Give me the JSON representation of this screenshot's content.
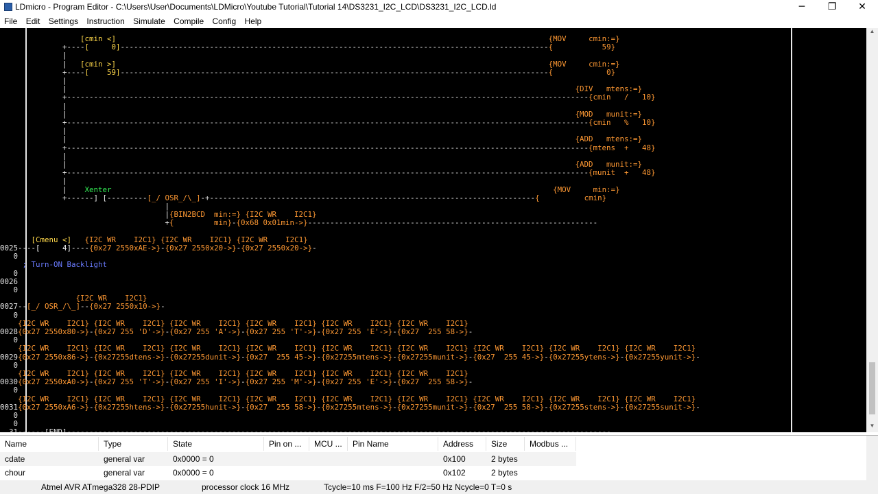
{
  "window": {
    "title": "LDmicro - Program Editor - C:\\Users\\User\\Documents\\LDMicro\\Youtube Tutorial\\Tutorial 14\\DS3231_I2C_LCD\\DS3231_I2C_LCD.ld",
    "minimize": "─",
    "maximize": "❐",
    "close": "✕"
  },
  "menu": [
    "File",
    "Edit",
    "Settings",
    "Instruction",
    "Simulate",
    "Compile",
    "Config",
    "Help"
  ],
  "editor": {
    "lines": [
      [
        {
          "t": "                  ",
          "c": "w"
        },
        {
          "t": "[cmin <]",
          "c": "y"
        },
        {
          "t": "                                                                                                 ",
          "c": "w"
        },
        {
          "t": "{MOV     cmin:=}",
          "c": "o"
        }
      ],
      [
        {
          "t": "              +----",
          "c": "w"
        },
        {
          "t": "[     0]",
          "c": "y"
        },
        {
          "t": "------------------------------------------------------------------------------------------------",
          "c": "w"
        },
        {
          "t": "{           59}",
          "c": "o"
        }
      ],
      [
        {
          "t": "              |",
          "c": "w"
        }
      ],
      [
        {
          "t": "              |   ",
          "c": "w"
        },
        {
          "t": "[cmin >]",
          "c": "y"
        },
        {
          "t": "                                                                                                 ",
          "c": "w"
        },
        {
          "t": "{MOV     cmin:=}",
          "c": "o"
        }
      ],
      [
        {
          "t": "              +----",
          "c": "w"
        },
        {
          "t": "[    59]",
          "c": "y"
        },
        {
          "t": "------------------------------------------------------------------------------------------------",
          "c": "w"
        },
        {
          "t": "{            0}",
          "c": "o"
        }
      ],
      [
        {
          "t": "              |",
          "c": "w"
        }
      ],
      [
        {
          "t": "              |                                                                                                                  ",
          "c": "w"
        },
        {
          "t": "{DIV   mtens:=}",
          "c": "o"
        }
      ],
      [
        {
          "t": "              +---------------------------------------------------------------------------------------------------------------------",
          "c": "w"
        },
        {
          "t": "{cmin   /   10}",
          "c": "o"
        }
      ],
      [
        {
          "t": "              |",
          "c": "w"
        }
      ],
      [
        {
          "t": "              |                                                                                                                  ",
          "c": "w"
        },
        {
          "t": "{MOD   munit:=}",
          "c": "o"
        }
      ],
      [
        {
          "t": "              +---------------------------------------------------------------------------------------------------------------------",
          "c": "w"
        },
        {
          "t": "{cmin   %   10}",
          "c": "o"
        }
      ],
      [
        {
          "t": "              |",
          "c": "w"
        }
      ],
      [
        {
          "t": "              |                                                                                                                  ",
          "c": "w"
        },
        {
          "t": "{ADD   mtens:=}",
          "c": "o"
        }
      ],
      [
        {
          "t": "              +---------------------------------------------------------------------------------------------------------------------",
          "c": "w"
        },
        {
          "t": "{mtens  +   48}",
          "c": "o"
        }
      ],
      [
        {
          "t": "              |",
          "c": "w"
        }
      ],
      [
        {
          "t": "              |                                                                                                                  ",
          "c": "w"
        },
        {
          "t": "{ADD   munit:=}",
          "c": "o"
        }
      ],
      [
        {
          "t": "              +---------------------------------------------------------------------------------------------------------------------",
          "c": "w"
        },
        {
          "t": "{munit  +   48}",
          "c": "o"
        }
      ],
      [
        {
          "t": "              |",
          "c": "w"
        }
      ],
      [
        {
          "t": "              |    ",
          "c": "w"
        },
        {
          "t": "Xenter",
          "c": "g"
        },
        {
          "t": "                                                                                                   ",
          "c": "w"
        },
        {
          "t": "{MOV     min:=}",
          "c": "o"
        }
      ],
      [
        {
          "t": "              +------] [---------",
          "c": "w"
        },
        {
          "t": "[_/ OSR_/\\_]",
          "c": "o"
        },
        {
          "t": "-+-------------------------------------------------------------------------",
          "c": "w"
        },
        {
          "t": "{          cmin}",
          "c": "o"
        }
      ],
      [
        {
          "t": "                                     |",
          "c": "w"
        }
      ],
      [
        {
          "t": "                                     |",
          "c": "w"
        },
        {
          "t": "{BIN2BCD  min:=}",
          "c": "o"
        },
        {
          "t": " ",
          "c": "w"
        },
        {
          "t": "{I2C WR    I2C1}",
          "c": "o"
        }
      ],
      [
        {
          "t": "                                     +",
          "c": "w"
        },
        {
          "t": "{         min}",
          "c": "o"
        },
        {
          "t": "-",
          "c": "w"
        },
        {
          "t": "{0x68 0x01min->}",
          "c": "o"
        },
        {
          "t": "-----------------------------------------------------------------",
          "c": "w"
        }
      ],
      [
        {
          "t": ""
        }
      ],
      [
        {
          "t": "       ",
          "c": "w"
        },
        {
          "t": "[Cmenu <]",
          "c": "y"
        },
        {
          "t": "   ",
          "c": "w"
        },
        {
          "t": "{I2C WR    I2C1}",
          "c": "o"
        },
        {
          "t": " ",
          "c": "w"
        },
        {
          "t": "{I2C WR    I2C1}",
          "c": "o"
        },
        {
          "t": " ",
          "c": "w"
        },
        {
          "t": "{I2C WR    I2C1}",
          "c": "o"
        }
      ],
      [
        {
          "t": "0025",
          "c": "w"
        },
        {
          "t": "----[     4]----",
          "c": "w"
        },
        {
          "t": "{0x27 2550xAE->}",
          "c": "o"
        },
        {
          "t": "-",
          "c": "w"
        },
        {
          "t": "{0x27 2550x20->}",
          "c": "o"
        },
        {
          "t": "-",
          "c": "w"
        },
        {
          "t": "{0x27 2550x20->}",
          "c": "o"
        },
        {
          "t": "-",
          "c": "w"
        }
      ],
      [
        {
          "t": "   0",
          "c": "w"
        }
      ],
      [
        {
          "t": "    ",
          "c": "w"
        },
        {
          "t": " ; Turn-ON Backlight",
          "c": "c"
        }
      ],
      [
        {
          "t": "   0",
          "c": "w"
        }
      ],
      [
        {
          "t": "0026",
          "c": "w"
        }
      ],
      [
        {
          "t": "   0",
          "c": "w"
        }
      ],
      [
        {
          "t": "                 ",
          "c": "w"
        },
        {
          "t": "{I2C WR    I2C1}",
          "c": "o"
        }
      ],
      [
        {
          "t": "0027",
          "c": "w"
        },
        {
          "t": "--",
          "c": "w"
        },
        {
          "t": "[_/ OSR_/\\_]",
          "c": "o"
        },
        {
          "t": "--",
          "c": "w"
        },
        {
          "t": "{0x27 2550x10->}",
          "c": "o"
        },
        {
          "t": "-",
          "c": "w"
        }
      ],
      [
        {
          "t": "   0",
          "c": "w"
        }
      ],
      [
        {
          "t": "    ",
          "c": "w"
        },
        {
          "t": "{I2C WR    I2C1}",
          "c": "o"
        },
        {
          "t": " ",
          "c": "w"
        },
        {
          "t": "{I2C WR    I2C1}",
          "c": "o"
        },
        {
          "t": " ",
          "c": "w"
        },
        {
          "t": "{I2C WR    I2C1}",
          "c": "o"
        },
        {
          "t": " ",
          "c": "w"
        },
        {
          "t": "{I2C WR    I2C1}",
          "c": "o"
        },
        {
          "t": " ",
          "c": "w"
        },
        {
          "t": "{I2C WR    I2C1}",
          "c": "o"
        },
        {
          "t": " ",
          "c": "w"
        },
        {
          "t": "{I2C WR    I2C1}",
          "c": "o"
        }
      ],
      [
        {
          "t": "0028",
          "c": "w"
        },
        {
          "t": "{0x27 2550x80->}",
          "c": "o"
        },
        {
          "t": "-",
          "c": "w"
        },
        {
          "t": "{0x27 255 'D'->}",
          "c": "o"
        },
        {
          "t": "-",
          "c": "w"
        },
        {
          "t": "{0x27 255 'A'->}",
          "c": "o"
        },
        {
          "t": "-",
          "c": "w"
        },
        {
          "t": "{0x27 255 'T'->}",
          "c": "o"
        },
        {
          "t": "-",
          "c": "w"
        },
        {
          "t": "{0x27 255 'E'->}",
          "c": "o"
        },
        {
          "t": "-",
          "c": "w"
        },
        {
          "t": "{0x27  255 58->}",
          "c": "o"
        },
        {
          "t": "-",
          "c": "w"
        }
      ],
      [
        {
          "t": "   0",
          "c": "w"
        }
      ],
      [
        {
          "t": "    ",
          "c": "w"
        },
        {
          "t": "{I2C WR    I2C1}",
          "c": "o"
        },
        {
          "t": " ",
          "c": "w"
        },
        {
          "t": "{I2C WR    I2C1}",
          "c": "o"
        },
        {
          "t": " ",
          "c": "w"
        },
        {
          "t": "{I2C WR    I2C1}",
          "c": "o"
        },
        {
          "t": " ",
          "c": "w"
        },
        {
          "t": "{I2C WR    I2C1}",
          "c": "o"
        },
        {
          "t": " ",
          "c": "w"
        },
        {
          "t": "{I2C WR    I2C1}",
          "c": "o"
        },
        {
          "t": " ",
          "c": "w"
        },
        {
          "t": "{I2C WR    I2C1}",
          "c": "o"
        },
        {
          "t": " ",
          "c": "w"
        },
        {
          "t": "{I2C WR    I2C1}",
          "c": "o"
        },
        {
          "t": " ",
          "c": "w"
        },
        {
          "t": "{I2C WR    I2C1}",
          "c": "o"
        },
        {
          "t": " ",
          "c": "w"
        },
        {
          "t": "{I2C WR    I2C1}",
          "c": "o"
        }
      ],
      [
        {
          "t": "0029",
          "c": "w"
        },
        {
          "t": "{0x27 2550x86->}",
          "c": "o"
        },
        {
          "t": "-",
          "c": "w"
        },
        {
          "t": "{0x27255dtens->}",
          "c": "o"
        },
        {
          "t": "-",
          "c": "w"
        },
        {
          "t": "{0x27255dunit->}",
          "c": "o"
        },
        {
          "t": "-",
          "c": "w"
        },
        {
          "t": "{0x27  255 45->}",
          "c": "o"
        },
        {
          "t": "-",
          "c": "w"
        },
        {
          "t": "{0x27255mtens->}",
          "c": "o"
        },
        {
          "t": "-",
          "c": "w"
        },
        {
          "t": "{0x27255munit->}",
          "c": "o"
        },
        {
          "t": "-",
          "c": "w"
        },
        {
          "t": "{0x27  255 45->}",
          "c": "o"
        },
        {
          "t": "-",
          "c": "w"
        },
        {
          "t": "{0x27255ytens->}",
          "c": "o"
        },
        {
          "t": "-",
          "c": "w"
        },
        {
          "t": "{0x27255yunit->}",
          "c": "o"
        },
        {
          "t": "-",
          "c": "w"
        }
      ],
      [
        {
          "t": "   0",
          "c": "w"
        }
      ],
      [
        {
          "t": "    ",
          "c": "w"
        },
        {
          "t": "{I2C WR    I2C1}",
          "c": "o"
        },
        {
          "t": " ",
          "c": "w"
        },
        {
          "t": "{I2C WR    I2C1}",
          "c": "o"
        },
        {
          "t": " ",
          "c": "w"
        },
        {
          "t": "{I2C WR    I2C1}",
          "c": "o"
        },
        {
          "t": " ",
          "c": "w"
        },
        {
          "t": "{I2C WR    I2C1}",
          "c": "o"
        },
        {
          "t": " ",
          "c": "w"
        },
        {
          "t": "{I2C WR    I2C1}",
          "c": "o"
        },
        {
          "t": " ",
          "c": "w"
        },
        {
          "t": "{I2C WR    I2C1}",
          "c": "o"
        }
      ],
      [
        {
          "t": "0030",
          "c": "w"
        },
        {
          "t": "{0x27 2550xA0->}",
          "c": "o"
        },
        {
          "t": "-",
          "c": "w"
        },
        {
          "t": "{0x27 255 'T'->}",
          "c": "o"
        },
        {
          "t": "-",
          "c": "w"
        },
        {
          "t": "{0x27 255 'I'->}",
          "c": "o"
        },
        {
          "t": "-",
          "c": "w"
        },
        {
          "t": "{0x27 255 'M'->}",
          "c": "o"
        },
        {
          "t": "-",
          "c": "w"
        },
        {
          "t": "{0x27 255 'E'->}",
          "c": "o"
        },
        {
          "t": "-",
          "c": "w"
        },
        {
          "t": "{0x27  255 58->}",
          "c": "o"
        },
        {
          "t": "-",
          "c": "w"
        }
      ],
      [
        {
          "t": "   0",
          "c": "w"
        }
      ],
      [
        {
          "t": "    ",
          "c": "w"
        },
        {
          "t": "{I2C WR    I2C1}",
          "c": "o"
        },
        {
          "t": " ",
          "c": "w"
        },
        {
          "t": "{I2C WR    I2C1}",
          "c": "o"
        },
        {
          "t": " ",
          "c": "w"
        },
        {
          "t": "{I2C WR    I2C1}",
          "c": "o"
        },
        {
          "t": " ",
          "c": "w"
        },
        {
          "t": "{I2C WR    I2C1}",
          "c": "o"
        },
        {
          "t": " ",
          "c": "w"
        },
        {
          "t": "{I2C WR    I2C1}",
          "c": "o"
        },
        {
          "t": " ",
          "c": "w"
        },
        {
          "t": "{I2C WR    I2C1}",
          "c": "o"
        },
        {
          "t": " ",
          "c": "w"
        },
        {
          "t": "{I2C WR    I2C1}",
          "c": "o"
        },
        {
          "t": " ",
          "c": "w"
        },
        {
          "t": "{I2C WR    I2C1}",
          "c": "o"
        },
        {
          "t": " ",
          "c": "w"
        },
        {
          "t": "{I2C WR    I2C1}",
          "c": "o"
        }
      ],
      [
        {
          "t": "0031",
          "c": "w"
        },
        {
          "t": "{0x27 2550xA6->}",
          "c": "o"
        },
        {
          "t": "-",
          "c": "w"
        },
        {
          "t": "{0x27255htens->}",
          "c": "o"
        },
        {
          "t": "-",
          "c": "w"
        },
        {
          "t": "{0x27255hunit->}",
          "c": "o"
        },
        {
          "t": "-",
          "c": "w"
        },
        {
          "t": "{0x27  255 58->}",
          "c": "o"
        },
        {
          "t": "-",
          "c": "w"
        },
        {
          "t": "{0x27255mtens->}",
          "c": "o"
        },
        {
          "t": "-",
          "c": "w"
        },
        {
          "t": "{0x27255munit->}",
          "c": "o"
        },
        {
          "t": "-",
          "c": "w"
        },
        {
          "t": "{0x27  255 58->}",
          "c": "o"
        },
        {
          "t": "-",
          "c": "w"
        },
        {
          "t": "{0x27255stens->}",
          "c": "o"
        },
        {
          "t": "-",
          "c": "w"
        },
        {
          "t": "{0x27255sunit->}",
          "c": "o"
        },
        {
          "t": "-",
          "c": "w"
        }
      ],
      [
        {
          "t": "   0",
          "c": "w"
        }
      ],
      [
        {
          "t": "   0",
          "c": "w"
        }
      ],
      [
        {
          "t": "  31",
          "c": "w"
        },
        {
          "t": "------[END]",
          "c": "w"
        },
        {
          "t": "--------------------------------------------------------------------------------------------------------------------------",
          "c": "w"
        }
      ]
    ]
  },
  "variables": {
    "columns": [
      "Name",
      "Type",
      "State",
      "Pin on ...",
      "MCU ...",
      "Pin Name",
      "Address",
      "Size",
      "Modbus ..."
    ],
    "rows": [
      {
        "name": "cdate",
        "type": "general var",
        "state": "0x0000 = 0",
        "address": "0x100",
        "size": "2 bytes"
      },
      {
        "name": "chour",
        "type": "general var",
        "state": "0x0000 = 0",
        "address": "0x102",
        "size": "2 bytes"
      }
    ]
  },
  "status": {
    "mcu": "Atmel AVR ATmega328 28-PDIP",
    "clock": "processor clock 16 MHz",
    "timing": "Tcycle=10 ms F=100 Hz F/2=50 Hz Ncycle=0 T=0 s"
  },
  "colors": {
    "editor_bg": "#000000",
    "rail": "#e8e8e8",
    "contact": "#ffd84a",
    "block": "#ff9933",
    "name": "#33ee55",
    "comment": "#6a7bff"
  }
}
